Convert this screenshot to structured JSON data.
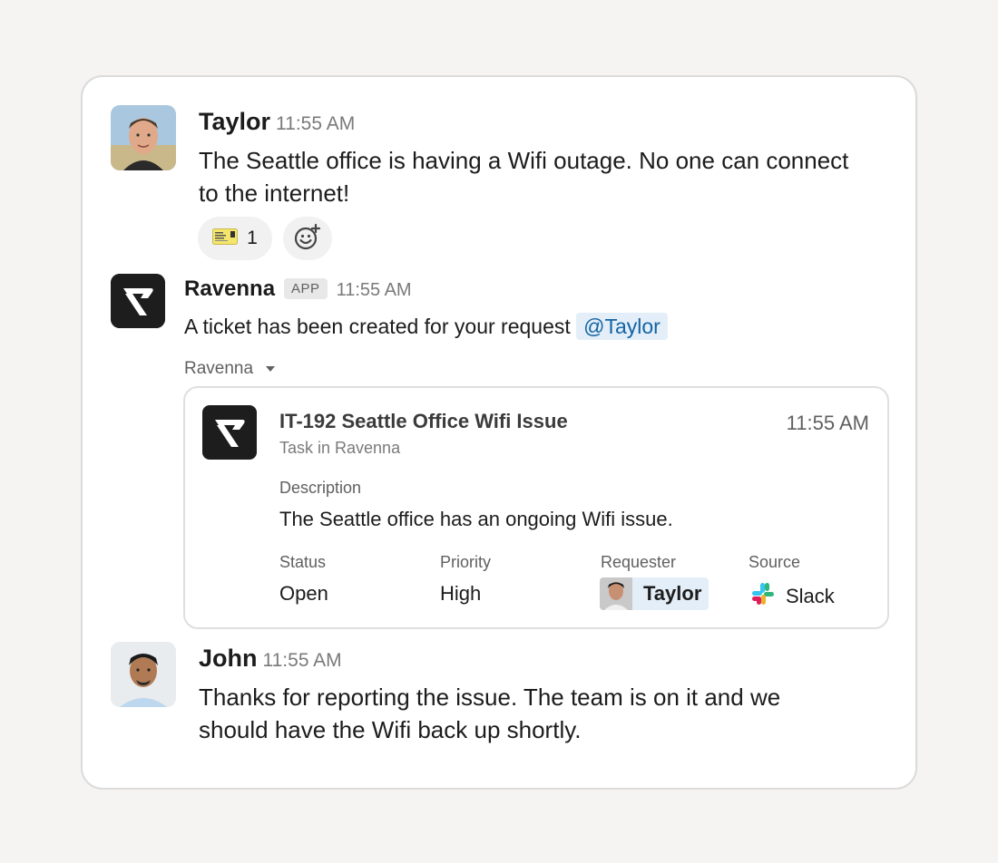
{
  "messages": [
    {
      "author": "Taylor",
      "time": "11:55 AM",
      "text_line1": "The Seattle office is having a Wifi outage. No one can connect",
      "text_line2": "to the internet!",
      "reactions": [
        {
          "icon": "ticket-emoji",
          "count": "1"
        },
        {
          "icon": "add-reaction-icon"
        }
      ]
    },
    {
      "author": "Ravenna",
      "badge": "APP",
      "time": "11:55 AM",
      "text": "A ticket has been created for your request",
      "mention": "@Taylor",
      "attachment_label": "Ravenna",
      "attachment": {
        "title": "IT-192 Seattle Office Wifi Issue",
        "subtitle": "Task in Ravenna",
        "time": "11:55 AM",
        "description_label": "Description",
        "description": "The Seattle office has an ongoing Wifi issue.",
        "fields": {
          "status_label": "Status",
          "status": "Open",
          "priority_label": "Priority",
          "priority": "High",
          "requester_label": "Requester",
          "requester": "Taylor",
          "source_label": "Source",
          "source": "Slack"
        }
      }
    },
    {
      "author": "John",
      "time": "11:55 AM",
      "text_line1": "Thanks for reporting the issue. The team is on it and we",
      "text_line2": "should have the Wifi back up shortly."
    }
  ],
  "colors": {
    "background": "#f5f4f3",
    "card": "#ffffff",
    "mention_bg": "#e3eef8",
    "mention_text": "#1264a3",
    "app_logo": "#1d1d1d"
  }
}
